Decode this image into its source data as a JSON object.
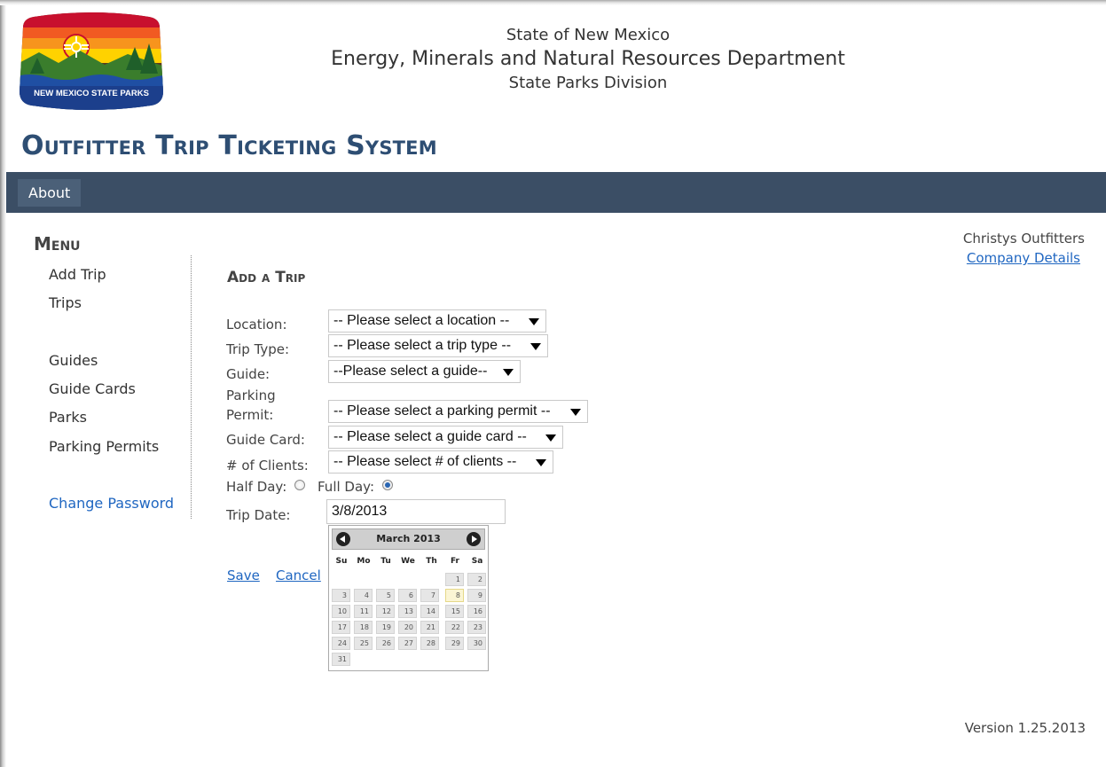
{
  "header": {
    "logo_text": "NEW MEXICO STATE PARKS",
    "line1": "State of New Mexico",
    "line2": "Energy, Minerals and Natural Resources Department",
    "line3": "State Parks Division",
    "system_title": "Outfitter Trip Ticketing System"
  },
  "nav": {
    "items": [
      {
        "label": "About"
      }
    ]
  },
  "sidebar": {
    "title": "Menu",
    "items": [
      {
        "label": "Add Trip"
      },
      {
        "label": "Trips"
      },
      {
        "label": "Guides"
      },
      {
        "label": "Guide Cards"
      },
      {
        "label": "Parks"
      },
      {
        "label": "Parking Permits"
      },
      {
        "label": "Change Password"
      }
    ]
  },
  "company": {
    "name": "Christys Outfitters",
    "details_link": "Company Details"
  },
  "form": {
    "title": "Add a Trip",
    "fields": {
      "location": {
        "label": "Location:",
        "value": "-- Please select a location --"
      },
      "trip_type": {
        "label": "Trip Type:",
        "value": "-- Please select a trip type --"
      },
      "guide": {
        "label": "Guide:",
        "value": "--Please select a guide--"
      },
      "parking_permit": {
        "label_line1": "Parking",
        "label_line2": "Permit:",
        "value": "-- Please select a parking permit --"
      },
      "guide_card": {
        "label": "Guide Card:",
        "value": "-- Please select a guide card --"
      },
      "clients": {
        "label": "# of Clients:",
        "value": "-- Please select # of clients --"
      },
      "duration": {
        "half_label": "Half Day:",
        "full_label": "Full Day:",
        "selected": "full"
      },
      "trip_date": {
        "label": "Trip Date:",
        "value": "3/8/2013"
      }
    },
    "save_label": "Save",
    "cancel_label": "Cancel"
  },
  "datepicker": {
    "month_label": "March 2013",
    "weekdays": [
      "Su",
      "Mo",
      "Tu",
      "We",
      "Th",
      "Fr",
      "Sa"
    ],
    "first_weekday_index": 5,
    "days_in_month": 31,
    "selected_day": 8
  },
  "footer": {
    "version": "Version 1.25.2013"
  },
  "colors": {
    "navbar": "#3b4e65",
    "title": "#2e4e73",
    "link": "#1f66c1"
  },
  "icons": {
    "logo": "state-parks-logo",
    "select_caret": "triangle-down",
    "datepicker_prev": "circle-arrow-left",
    "datepicker_next": "circle-arrow-right"
  }
}
